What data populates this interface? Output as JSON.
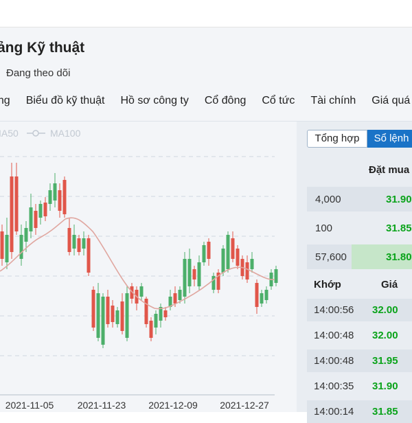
{
  "header": {
    "title": "ảng Kỹ thuật",
    "follow_label": "Đang theo dõi",
    "tabs": [
      "ổng",
      "Biểu đồ kỹ thuật",
      "Hồ sơ công ty",
      "Cổ đông",
      "Cổ tức",
      "Tài chính",
      "Giá quá"
    ]
  },
  "chart": {
    "legend": [
      "IA50",
      "MA100"
    ],
    "x_labels": [
      "2021-11-05",
      "2021-11-23",
      "2021-12-09",
      "2021-12-27"
    ],
    "colors": {
      "up": "#4caf6a",
      "down": "#e0564a",
      "ma": "#e0a7a0",
      "grid": "#cfd6df"
    }
  },
  "panel": {
    "seg_summary": "Tổng hợp",
    "seg_orders": "Sổ lệnh",
    "bid_header": "Đặt mua",
    "bids": [
      {
        "vol": "4,000",
        "price": "31.90"
      },
      {
        "vol": "100",
        "price": "31.85"
      },
      {
        "vol": "57,600",
        "price": "31.80"
      }
    ],
    "match_header": "Khớp",
    "price_header": "Giá",
    "matches": [
      {
        "time": "14:00:56",
        "price": "32.00"
      },
      {
        "time": "14:00:48",
        "price": "32.00"
      },
      {
        "time": "14:00:48",
        "price": "31.95"
      },
      {
        "time": "14:00:35",
        "price": "31.90"
      },
      {
        "time": "14:00:14",
        "price": "31.85"
      }
    ]
  }
}
